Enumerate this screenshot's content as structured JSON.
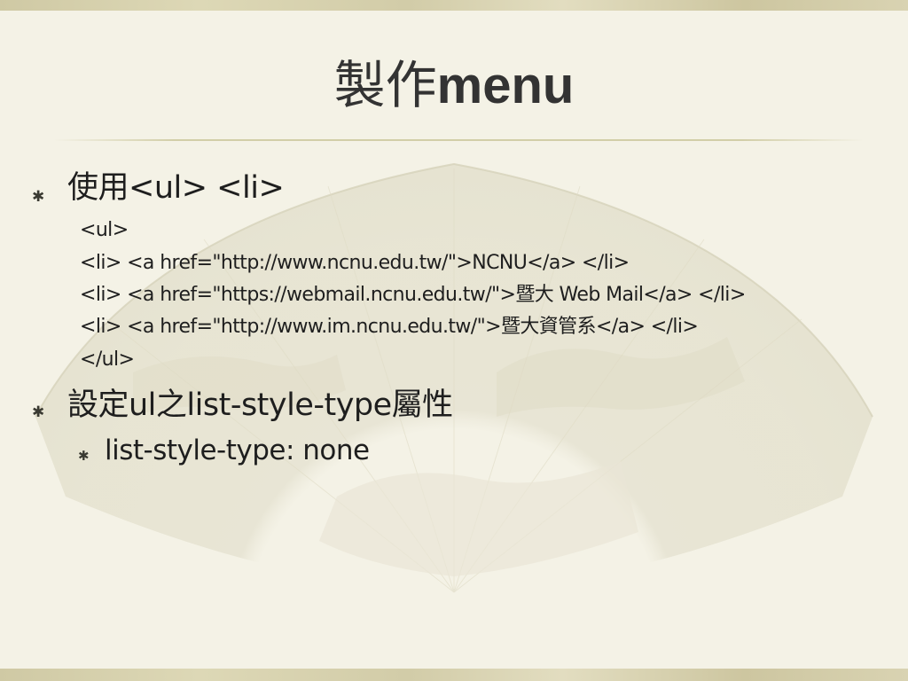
{
  "slide": {
    "title_cjk": "製作",
    "title_latin": "menu",
    "bullets": [
      {
        "text": "使用<ul> <li>",
        "code": [
          "<ul>",
          "<li> <a href=\"http://www.ncnu.edu.tw/\">NCNU</a> </li>",
          "<li> <a href=\"https://webmail.ncnu.edu.tw/\">暨大 Web Mail</a> </li>",
          "<li> <a href=\"http://www.im.ncnu.edu.tw/\">暨大資管系</a> </li>",
          "</ul>"
        ]
      },
      {
        "text": "設定ul之list-style-type屬性",
        "sub": [
          "list-style-type: none"
        ]
      }
    ],
    "bullet_symbol": "✱",
    "icons": {
      "bullet": "asterisk-bullet-icon",
      "background": "folding-fan-icon"
    },
    "colors": {
      "background": "#f4f2e6",
      "band": "#d3cda8",
      "text": "#1e1e1e",
      "title": "#333333"
    }
  }
}
